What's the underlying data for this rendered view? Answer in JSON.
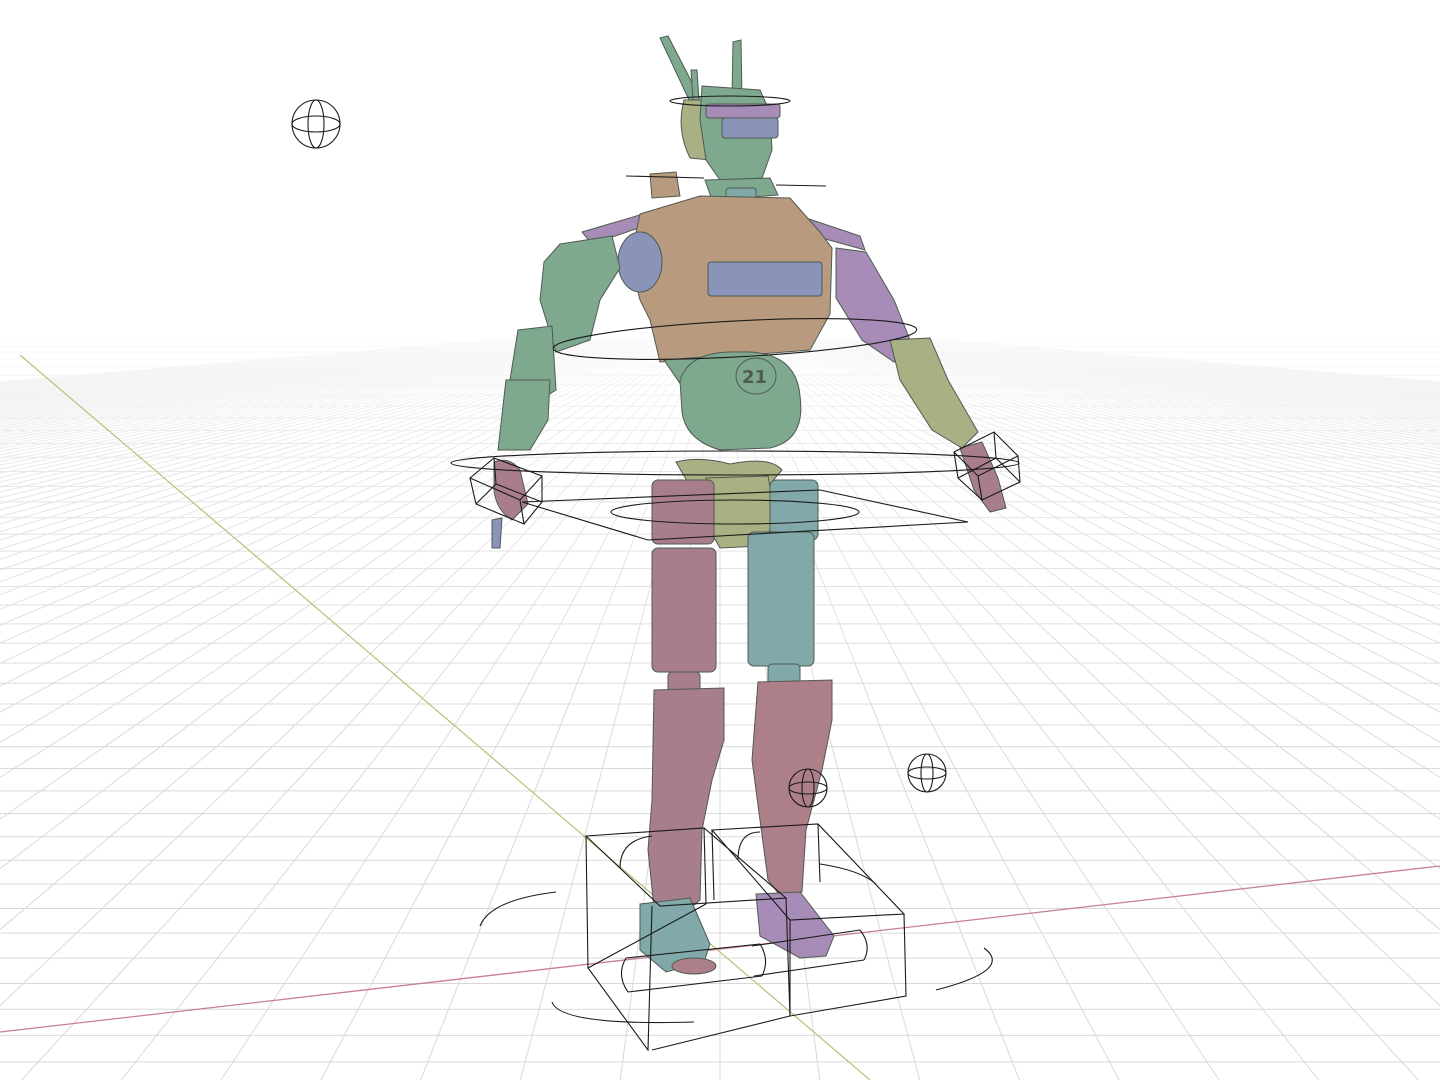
{
  "viewport": {
    "background_color": "#ffffff",
    "grid_color": "#d9d9d9",
    "x_axis_color": "#c87f8e",
    "y_axis_color": "#b4c27a"
  },
  "model": {
    "number_label": "21",
    "colors": {
      "sage": "#7fa98f",
      "tan": "#b89a7e",
      "mauve": "#a97e8c",
      "lavender": "#a78cb8",
      "teal": "#82a9a9",
      "olive": "#a9b083",
      "rose": "#ad7f89",
      "slate": "#8a93b8",
      "outline_dark": "#4f5a52"
    }
  },
  "icons": {
    "empty_target": "sphere-empty-icon",
    "control_shape": "rig-control-icon"
  }
}
